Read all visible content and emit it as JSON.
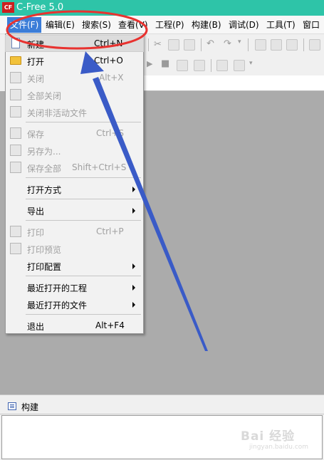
{
  "window": {
    "title": "C-Free 5.0",
    "app_icon_text": "CF"
  },
  "menubar": {
    "items": [
      "文件(F)",
      "编辑(E)",
      "搜索(S)",
      "查看(V)",
      "工程(P)",
      "构建(B)",
      "调试(D)",
      "工具(T)",
      "窗口"
    ],
    "active_index": 0
  },
  "file_menu": {
    "items": [
      {
        "label": "新建",
        "shortcut": "Ctrl+N",
        "icon": "new-file-icon",
        "enabled": true,
        "highlighted": true
      },
      {
        "label": "打开",
        "shortcut": "Ctrl+O",
        "icon": "open-folder-icon",
        "enabled": true
      },
      {
        "label": "关闭",
        "shortcut": "Alt+X",
        "icon": "close-file-icon",
        "enabled": false
      },
      {
        "label": "全部关闭",
        "shortcut": "",
        "icon": "close-all-icon",
        "enabled": false
      },
      {
        "label": "关闭非活动文件",
        "shortcut": "",
        "icon": "close-inactive-icon",
        "enabled": false
      },
      {
        "label": "保存",
        "shortcut": "Ctrl+S",
        "icon": "save-icon",
        "enabled": false
      },
      {
        "label": "另存为...",
        "shortcut": "",
        "icon": "save-as-icon",
        "enabled": false
      },
      {
        "label": "保存全部",
        "shortcut": "Shift+Ctrl+S",
        "icon": "save-all-icon",
        "enabled": false
      },
      {
        "label": "打开方式",
        "shortcut": "",
        "icon": "",
        "enabled": true,
        "submenu": true
      },
      {
        "label": "导出",
        "shortcut": "",
        "icon": "",
        "enabled": true,
        "submenu": true
      },
      {
        "label": "打印",
        "shortcut": "Ctrl+P",
        "icon": "print-icon",
        "enabled": false
      },
      {
        "label": "打印预览",
        "shortcut": "",
        "icon": "print-preview-icon",
        "enabled": false
      },
      {
        "label": "打印配置",
        "shortcut": "",
        "icon": "",
        "enabled": true,
        "submenu": true
      },
      {
        "label": "最近打开的工程",
        "shortcut": "",
        "icon": "",
        "enabled": true,
        "submenu": true
      },
      {
        "label": "最近打开的文件",
        "shortcut": "",
        "icon": "",
        "enabled": true,
        "submenu": true
      },
      {
        "label": "退出",
        "shortcut": "Alt+F4",
        "icon": "",
        "enabled": true
      }
    ]
  },
  "output_panel": {
    "title": "构建"
  },
  "annotation": {
    "circle_color": "#e8322f",
    "arrow_color": "#3a5bc7"
  },
  "watermark": {
    "text": "Bai 经验",
    "url": "jingyan.baidu.com"
  }
}
